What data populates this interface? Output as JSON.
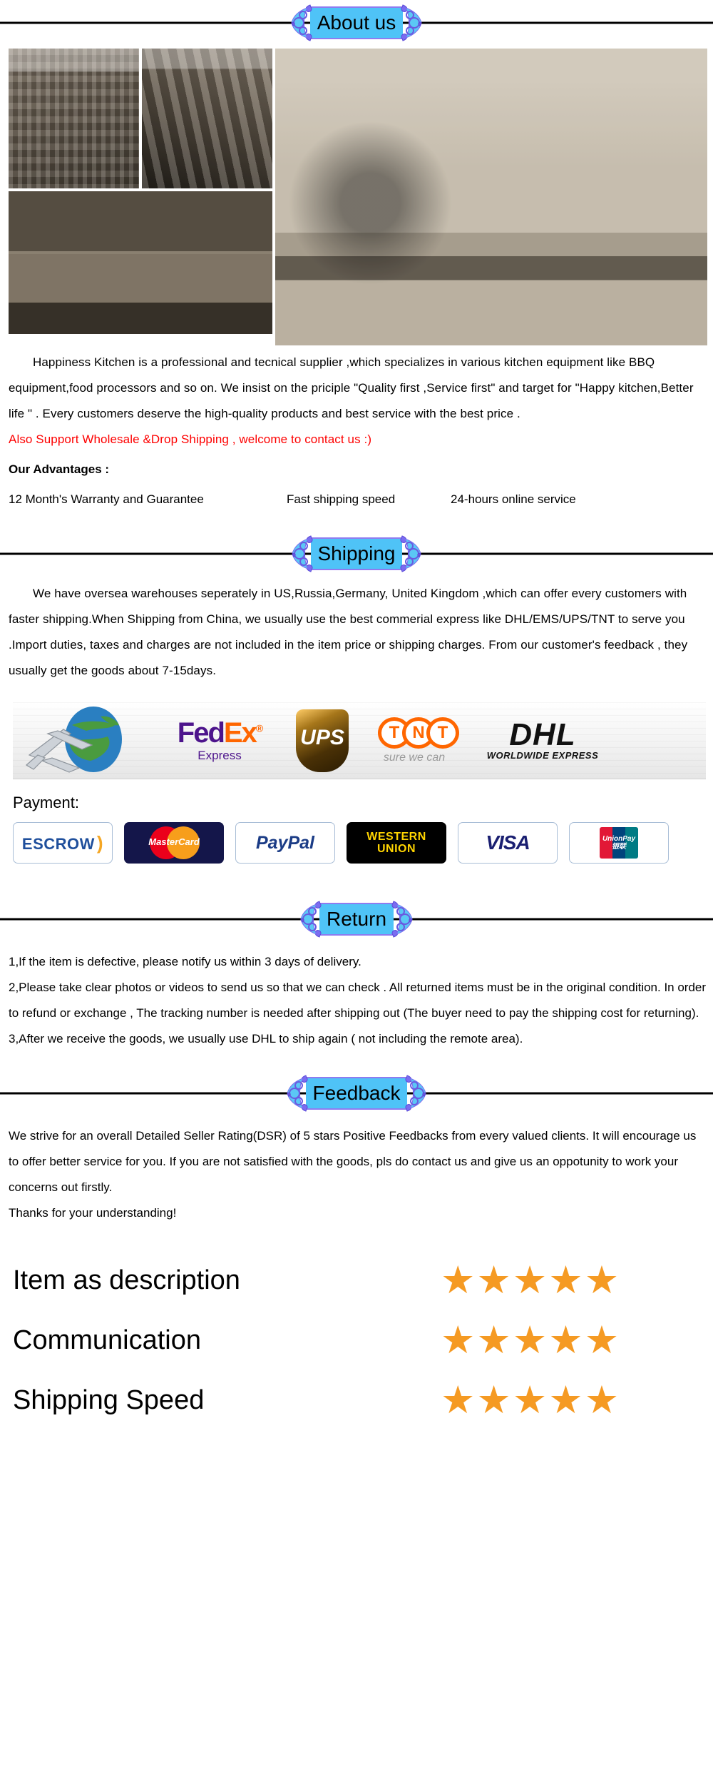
{
  "colors": {
    "banner_plate": "#4fc3f7",
    "banner_ornament": "#6a5ae0",
    "highlight_red": "#fe0000",
    "star_orange": "#f59a23",
    "rule_black": "#000000"
  },
  "sections": {
    "about": {
      "banner_label": "About us",
      "photos": [
        {
          "name": "warehouse-boxes-photo",
          "alt": "Warehouse stacked with packed cartons"
        },
        {
          "name": "production-line-photo",
          "alt": "Row of food processor machines on production line"
        },
        {
          "name": "factory-building-photo",
          "alt": "Exterior view of the factory office building"
        },
        {
          "name": "kitchen-interior-photo",
          "alt": "Modern kitchen with island, pendant lights and stools"
        }
      ],
      "paragraphs": [
        "Happiness Kitchen is a professional and tecnical supplier ,which specializes in various kitchen equipment like BBQ equipment,food processors and so on. We insist on the priciple \"Quality first ,Service first\" and target for \"Happy kitchen,Better life \" . Every customers deserve the high-quality products and best service with the best price ."
      ],
      "highlight": "Also Support  Wholesale &Drop Shipping , welcome to contact us :)",
      "advantages_title": "Our Advantages :",
      "advantages": [
        "12 Month's Warranty and Guarantee",
        "Fast shipping speed",
        "24-hours online service"
      ]
    },
    "shipping": {
      "banner_label": "Shipping",
      "paragraphs": [
        "We have oversea warehouses seperately in US,Russia,Germany, United Kingdom ,which can offer every customers with faster shipping.When Shipping from China, we usually use the best commerial express like DHL/EMS/UPS/TNT to serve you .Import duties, taxes and charges are not included in the item price or shipping charges. From our customer's feedback , they usually get the goods about 7-15days."
      ],
      "carriers": [
        {
          "name": "air-globe-icon",
          "label": ""
        },
        {
          "name": "fedex-logo",
          "label": "FedEx",
          "label_fed": "Fed",
          "label_ex": "Ex",
          "sub": "Express"
        },
        {
          "name": "ups-logo",
          "label": "UPS"
        },
        {
          "name": "tnt-logo",
          "label": "TNT",
          "letters": [
            "T",
            "N",
            "T"
          ],
          "sub": "sure we can"
        },
        {
          "name": "dhl-logo",
          "label": "DHL",
          "sub": "WORLDWIDE EXPRESS"
        }
      ],
      "payment_title": "Payment:",
      "payments": [
        {
          "name": "escrow-logo",
          "label": "ESCROW"
        },
        {
          "name": "mastercard-logo",
          "label": "MasterCard"
        },
        {
          "name": "paypal-logo",
          "label": "PayPal"
        },
        {
          "name": "western-union-logo",
          "label": "WESTERN",
          "label2": "UNION"
        },
        {
          "name": "visa-logo",
          "label": "VISA"
        },
        {
          "name": "unionpay-logo",
          "label": "UnionPay",
          "label2": "银联"
        }
      ]
    },
    "return": {
      "banner_label": "Return",
      "items": [
        "1,If the item is defective, please notify us within 3 days of delivery.",
        "2,Please take clear photos or videos to send us so that we can check . All returned items must be in the original condition. In order to refund or exchange , The tracking number is needed after shipping out (The buyer need to pay the shipping cost for returning).",
        "3,After we receive the goods, we usually use DHL to ship again ( not including the remote area)."
      ]
    },
    "feedback": {
      "banner_label": "Feedback",
      "paragraphs": [
        "We strive for an overall Detailed Seller Rating(DSR) of 5 stars Positive Feedbacks from every valued clients. It will encourage us to offer better service for you. If you are not satisfied with the goods, pls do contact us and give us an oppotunity to work your concerns out firstly.",
        "Thanks for your understanding!"
      ],
      "ratings": [
        {
          "label": "Item as description",
          "stars": 5
        },
        {
          "label": "Communication",
          "stars": 5
        },
        {
          "label": "Shipping Speed",
          "stars": 5
        }
      ]
    }
  }
}
